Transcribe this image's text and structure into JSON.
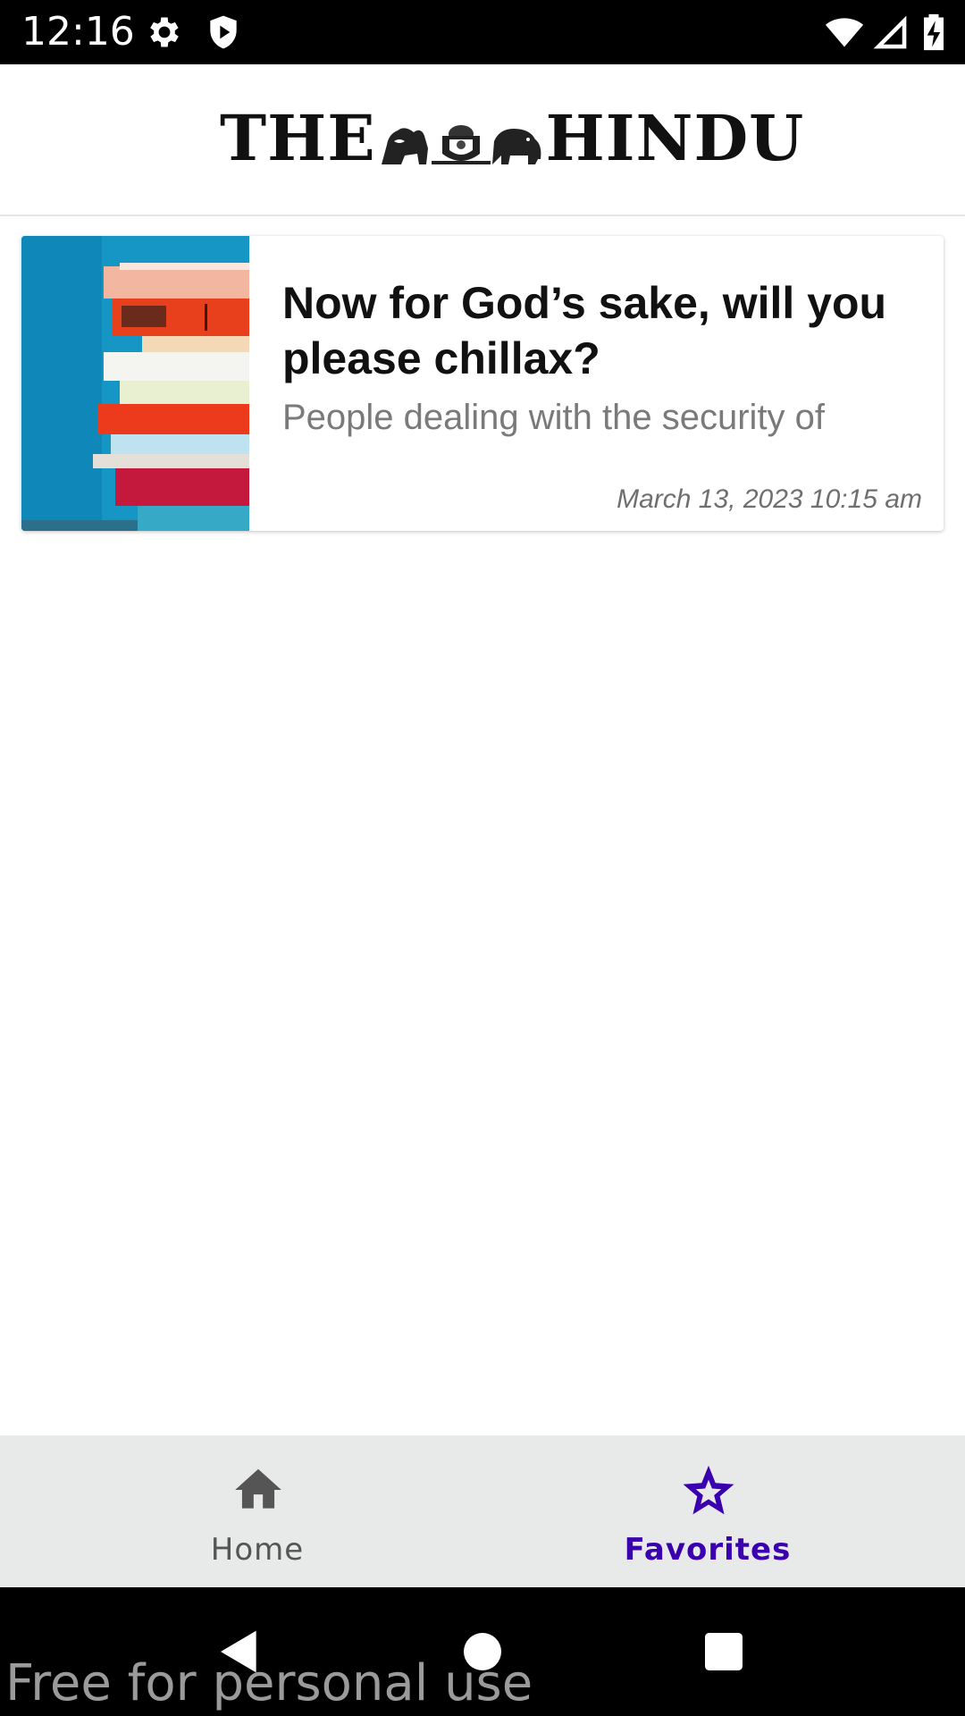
{
  "status_bar": {
    "time": "12:16",
    "icons": [
      "settings-icon",
      "shield-icon",
      "wifi-icon",
      "signal-icon",
      "battery-charging-icon"
    ]
  },
  "header": {
    "logo_left": "THE",
    "logo_right": "HINDU"
  },
  "articles": [
    {
      "title": "Now for God’s sake, will you please chillax?",
      "summary": "People dealing with the security of",
      "date": "March 13, 2023 10:15 am",
      "thumbnail": "stacked-books-image"
    }
  ],
  "bottom_nav": {
    "items": [
      {
        "label": "Home",
        "icon": "home-icon",
        "selected": false
      },
      {
        "label": "Favorites",
        "icon": "star-icon",
        "selected": true
      }
    ],
    "active_color": "#3a00b0",
    "inactive_color": "#555555"
  },
  "system_nav": {
    "buttons": [
      "back-icon",
      "home-circle-icon",
      "recents-icon"
    ]
  },
  "watermark": "Free for personal use"
}
